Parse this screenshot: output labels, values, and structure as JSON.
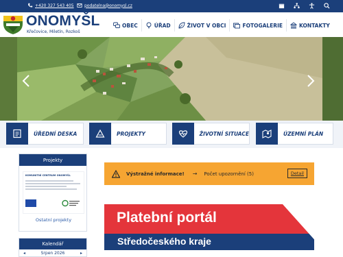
{
  "topbar": {
    "phone": "+420 327 543 405",
    "email": "podatelna@onomysl.cz",
    "icons": [
      "phone-icon",
      "mail-icon",
      "calendar-icon",
      "sitemap-icon",
      "accessibility-icon",
      "search-icon"
    ]
  },
  "brand": {
    "title": "ONOMYŠL",
    "subtitle": "Křečovice, Miletín, Rozkoš"
  },
  "nav": {
    "items": [
      {
        "label": "OBEC",
        "icon": "speech-bubbles-icon"
      },
      {
        "label": "ÚŘAD",
        "icon": "lightbulb-icon"
      },
      {
        "label": "ŽIVOT V OBCI",
        "icon": "leaf-icon"
      },
      {
        "label": "FOTOGALERIE",
        "icon": "photos-icon"
      },
      {
        "label": "KONTAKTY",
        "icon": "building-icon"
      }
    ]
  },
  "tiles": [
    {
      "label": "ÚŘEDNÍ DESKA",
      "icon": "board-icon"
    },
    {
      "label": "PROJEKTY",
      "icon": "projects-icon"
    },
    {
      "label": "ŽIVOTNÍ SITUACE",
      "icon": "heartbeat-icon"
    },
    {
      "label": "ÚZEMNÍ PLÁN",
      "icon": "map-pin-icon"
    }
  ],
  "sidebar": {
    "projects_title": "Projekty",
    "doc_title": "KOMUNITNÍ CENTRUM ONOMYŠL",
    "projects_link": "Ostatní projekty",
    "calendar_title": "Kalendář",
    "calendar_month": "Srpen 2026"
  },
  "alert": {
    "label": "Výstražné informace!",
    "arrow": "→",
    "count_text": "Počet upozornění (5)",
    "detail": "Detail"
  },
  "banner": {
    "line1": "Platební portál",
    "line2": "Středočeského kraje"
  },
  "colors": {
    "navy": "#1b3f7a",
    "alert_orange": "#f6a532",
    "banner_red": "#e4353b"
  }
}
